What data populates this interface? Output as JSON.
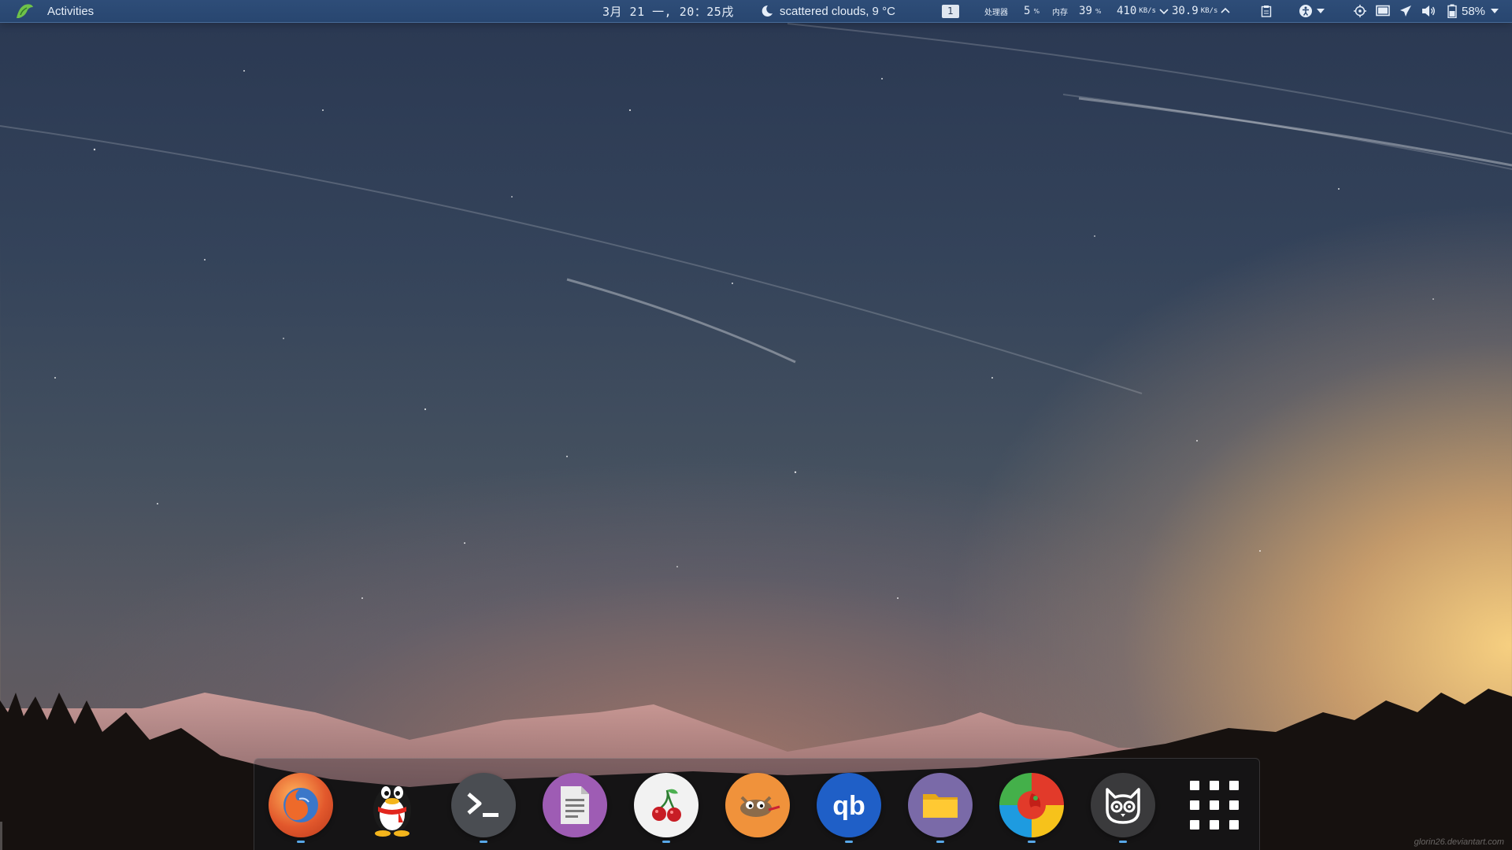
{
  "topbar": {
    "activities_label": "Activities",
    "clock": "3月 21 一, 20：25戌",
    "weather": {
      "icon": "moon-cloud-icon",
      "text": "scattered clouds, 9 °C"
    },
    "workspace_number": "1",
    "sysmon": {
      "cpu_label": "处理器",
      "cpu_value": "5",
      "cpu_unit": "%",
      "mem_label": "内存",
      "mem_value": "39",
      "mem_unit": "%"
    },
    "net": {
      "down": "410",
      "down_unit": "KB/s",
      "up": "30.9",
      "up_unit": "KB/s"
    },
    "battery_percent": "58%",
    "tray_icons": [
      "clipboard-icon",
      "accessibility-icon",
      "location-icon",
      "display-icon",
      "airplane-mode-icon",
      "volume-icon",
      "battery-icon"
    ]
  },
  "dock": {
    "items": [
      {
        "name": "firefox",
        "icon": "firefox-icon",
        "running": true,
        "color": "#e2582c"
      },
      {
        "name": "qq",
        "icon": "qq-penguin-icon",
        "running": false,
        "color": "#222222"
      },
      {
        "name": "terminal",
        "icon": "terminal-icon",
        "running": true,
        "color": "#4a4d52"
      },
      {
        "name": "text-editor",
        "icon": "document-icon",
        "running": false,
        "color": "#9e5cb4"
      },
      {
        "name": "cherry",
        "icon": "cherry-icon",
        "running": true,
        "color": "#f2f2f2"
      },
      {
        "name": "gimp",
        "icon": "gimp-icon",
        "running": false,
        "color": "#f0923b"
      },
      {
        "name": "qbittorrent",
        "icon": "qbittorrent-icon",
        "running": true,
        "color": "#1f5fc7"
      },
      {
        "name": "files",
        "icon": "folder-icon",
        "running": true,
        "color": "#7a6aa8"
      },
      {
        "name": "shotwell",
        "icon": "shotwell-icon",
        "running": true,
        "color": "#e23a2a"
      },
      {
        "name": "owl",
        "icon": "owl-icon",
        "running": true,
        "color": "#3a3a3c"
      },
      {
        "name": "app-grid",
        "icon": "app-grid-icon",
        "running": false,
        "color": "#ffffff"
      }
    ]
  },
  "watermark": "glorin26.deviantart.com"
}
